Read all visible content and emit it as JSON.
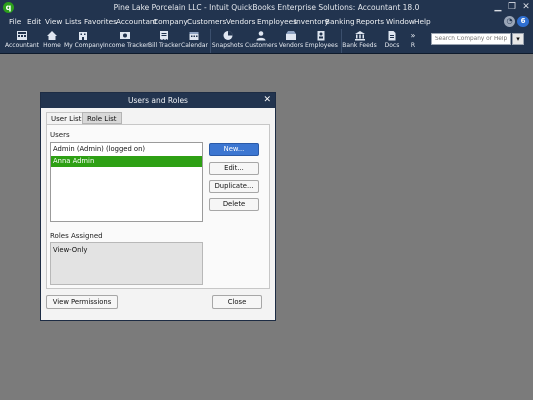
{
  "window": {
    "title": "Pine Lake Porcelain LLC  - Intuit QuickBooks Enterprise Solutions: Accountant 18.0",
    "logo_glyph": "q",
    "minimize": "▁",
    "restore": "❐",
    "close": "✕"
  },
  "menubar": {
    "items": [
      "File",
      "Edit",
      "View",
      "Lists",
      "Favorites",
      "Accountant",
      "Company",
      "Customers",
      "Vendors",
      "Employees",
      "Inventory",
      "Banking",
      "Reports",
      "Window",
      "Help"
    ],
    "bell_glyph": "◔",
    "badge_count": "6"
  },
  "iconbar": {
    "items": [
      {
        "label": "Accountant",
        "icon": "accountant-icon"
      },
      {
        "label": "Home",
        "icon": "home-icon"
      },
      {
        "label": "My Company",
        "icon": "my-company-icon"
      },
      {
        "label": "Income Tracker",
        "icon": "income-tracker-icon"
      },
      {
        "label": "Bill Tracker",
        "icon": "bill-tracker-icon"
      },
      {
        "label": "Calendar",
        "icon": "calendar-icon"
      },
      {
        "label": "Snapshots",
        "icon": "snapshots-icon"
      },
      {
        "label": "Customers",
        "icon": "customers-icon"
      },
      {
        "label": "Vendors",
        "icon": "vendors-icon"
      },
      {
        "label": "Employees",
        "icon": "employees-icon"
      },
      {
        "label": "Bank Feeds",
        "icon": "bank-feeds-icon"
      },
      {
        "label": "Docs",
        "icon": "docs-icon"
      },
      {
        "label": "R",
        "icon": "more-icon"
      }
    ],
    "more_glyph": "»",
    "search_placeholder": "Search Company or Help",
    "search_go_glyph": "▾"
  },
  "dialog": {
    "title": "Users and Roles",
    "close_glyph": "✕",
    "tabs": [
      {
        "label": "User List",
        "active": true
      },
      {
        "label": "Role List",
        "active": false
      }
    ],
    "users_label": "Users",
    "users": [
      {
        "name": "Admin (Admin) (logged on)",
        "selected": false
      },
      {
        "name": "Anna Admin",
        "selected": true
      }
    ],
    "buttons": {
      "new": "New...",
      "edit": "Edit...",
      "duplicate": "Duplicate...",
      "delete": "Delete"
    },
    "roles_label": "Roles Assigned",
    "roles": [
      "View-Only"
    ],
    "view_permissions": "View Permissions",
    "close": "Close"
  },
  "colors": {
    "chrome": "#22344f",
    "workspace": "#7b7b7b",
    "selection": "#2ea014",
    "primary_button": "#3c76d1"
  }
}
